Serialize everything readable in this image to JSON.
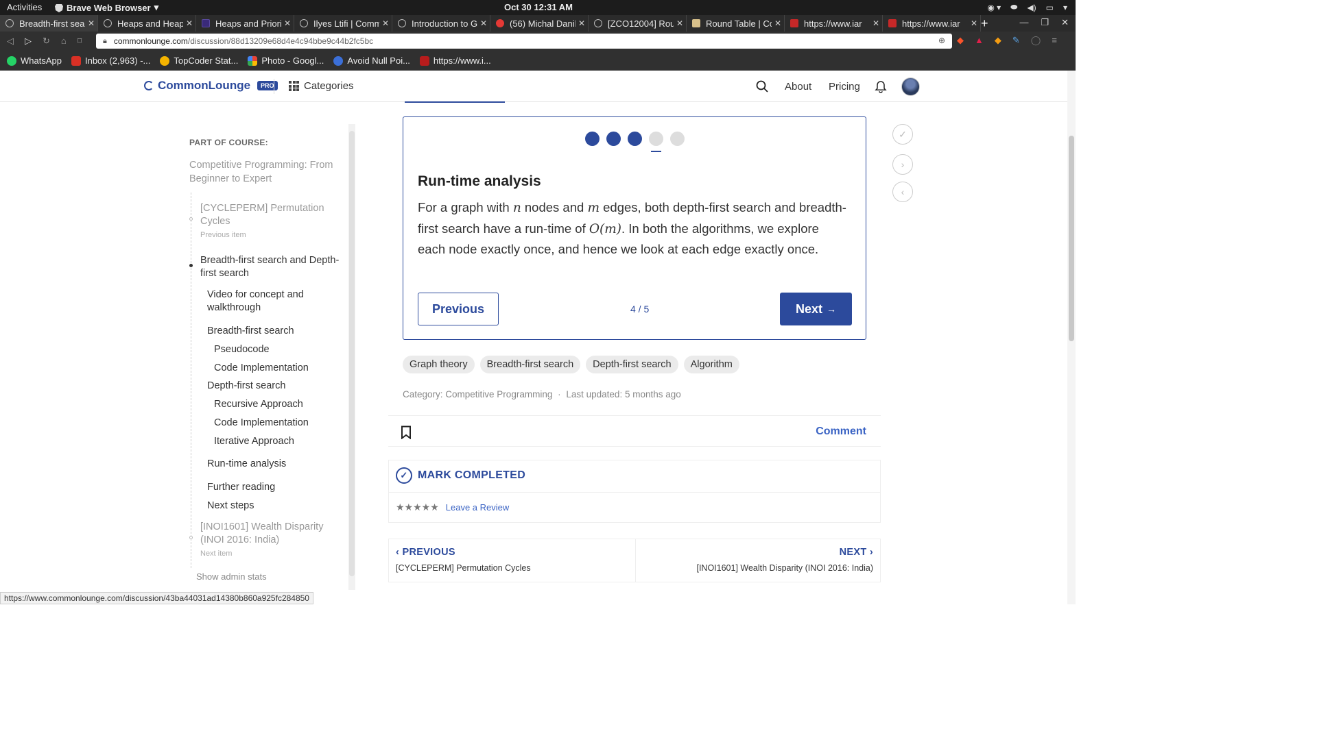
{
  "system": {
    "activities": "Activities",
    "app_name": "Brave Web Browser",
    "clock": "Oct 30  12:31 AM"
  },
  "tabs": [
    {
      "title": "Breadth-first sea",
      "active": true
    },
    {
      "title": "Heaps and Heap"
    },
    {
      "title": "Heaps and Priorit"
    },
    {
      "title": "Ilyes Ltifi | Comm"
    },
    {
      "title": "Introduction to G"
    },
    {
      "title": "(56) Michal Danil"
    },
    {
      "title": "[ZCO12004] Roun"
    },
    {
      "title": "Round Table | Co"
    },
    {
      "title": "https://www.iar"
    },
    {
      "title": "https://www.iar"
    }
  ],
  "address": {
    "domain": "commonlounge.com",
    "path": "/discussion/88d13209e68d4e4c94bbe9c44b2fc5bc"
  },
  "bookmarks": [
    {
      "label": "WhatsApp",
      "color": "#25d366"
    },
    {
      "label": "Inbox (2,963) -...",
      "color": "#d93025"
    },
    {
      "label": "TopCoder Stat...",
      "color": "#f5b400"
    },
    {
      "label": "Photo - Googl...",
      "color": "#ea4335"
    },
    {
      "label": "Avoid Null Poi...",
      "color": "#3b6fd8"
    },
    {
      "label": "https://www.i...",
      "color": "#b71c1c"
    }
  ],
  "header": {
    "logo": "CommonLounge",
    "pro_badge": "PRO",
    "categories": "Categories",
    "about": "About",
    "pricing": "Pricing"
  },
  "sidebar": {
    "title": "PART OF COURSE:",
    "course": "Competitive Programming: From Beginner to Expert",
    "prev_item": "[CYCLEPERM] Permutation Cycles",
    "prev_caption": "Previous item",
    "current": "Breadth-first search and Depth-first search",
    "outline": [
      "Video for concept and walkthrough",
      "Breadth-first search",
      "Pseudocode",
      "Code Implementation",
      "Depth-first search",
      "Recursive Approach",
      "Code Implementation",
      "Iterative Approach",
      "Run-time analysis",
      "Further reading",
      "Next steps"
    ],
    "next_item": "[INOI1601] Wealth Disparity (INOI 2016: India)",
    "next_caption": "Next item",
    "admin": "Show admin stats"
  },
  "card": {
    "progress_total": 5,
    "progress_current": 4,
    "heading": "Run-time analysis",
    "body_1": "For a graph with ",
    "var_n": "n",
    "body_2": " nodes and ",
    "var_m": "m",
    "body_3": " edges, both depth-first search and breadth-first search have a run-time of ",
    "big_o": "O(m)",
    "body_4": ". In both the algorithms, we explore each node exactly once, and hence we look at each edge exactly once.",
    "prev_label": "Previous",
    "counter": "4 / 5",
    "next_label": "Next",
    "next_arrow": "→"
  },
  "tags": [
    "Graph theory",
    "Breadth-first search",
    "Depth-first search",
    "Algorithm"
  ],
  "meta": {
    "category": "Category: Competitive Programming",
    "sep": "·",
    "updated": "Last updated: 5 months ago"
  },
  "actions": {
    "comment": "Comment"
  },
  "mark": {
    "label": "MARK COMPLETED",
    "stars": "★★★★★",
    "review": "Leave a Review"
  },
  "pager": {
    "prev_head": "PREVIOUS",
    "prev_title": "[CYCLEPERM] Permutation Cycles",
    "next_head": "NEXT",
    "next_title": "[INOI1601] Wealth Disparity (INOI 2016: India)"
  },
  "status_url": "https://www.commonlounge.com/discussion/43ba44031ad14380b860a925fc284850",
  "colors": {
    "brand": "#2c4a9c",
    "link": "#3a63c4"
  }
}
